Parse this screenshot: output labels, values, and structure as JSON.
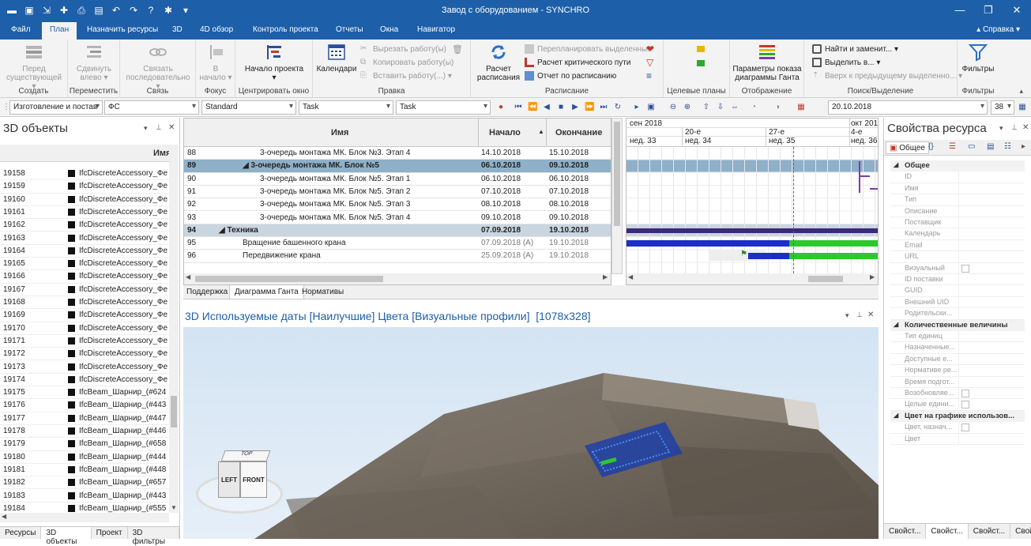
{
  "window": {
    "title": "Завод с оборудованием - SYNCHRO"
  },
  "menu": {
    "tabs": [
      "Файл",
      "План",
      "Назначить ресурсы",
      "3D",
      "4D обзор",
      "Контроль проекта",
      "Отчеты",
      "Окна",
      "Навигатор"
    ],
    "help": "Справка"
  },
  "ribbon": {
    "groups": [
      {
        "label": "Создать",
        "buttons": [
          "Перед существующей ▾"
        ]
      },
      {
        "label": "Переместить",
        "buttons": [
          "Сдвинуть влево ▾"
        ]
      },
      {
        "label": "Связь",
        "buttons": [
          "Связать последовательно ▾"
        ]
      },
      {
        "label": "Фокус",
        "buttons": [
          "В начало ▾"
        ]
      },
      {
        "label": "Центрировать окно",
        "buttons": [
          "Начало проекта ▾"
        ]
      },
      {
        "label": "Правка",
        "buttons": [
          "Календари"
        ],
        "small": [
          "Вырезать работу(ы)",
          "Копировать работу(ы)",
          "Вставить работу(...) ▾"
        ]
      },
      {
        "label": "Расписание",
        "buttons": [
          "Расчет расписания"
        ],
        "small": [
          "Перепланировать выделенные",
          "Расчет критического пути",
          "Отчет по расписанию"
        ]
      },
      {
        "label": "Целевые планы",
        "buttons": []
      },
      {
        "label": "Отображение",
        "buttons": [
          "Параметры показа диаграммы Ганта"
        ]
      },
      {
        "label": "Поиск/Выделение",
        "buttons": [],
        "small": [
          "Найти и заменит... ▾",
          "Выделить в... ▾",
          "Вверх к предыдущему выделенно... ▾"
        ]
      },
      {
        "label": "Фильтры",
        "buttons": [
          "Фильтры"
        ]
      }
    ]
  },
  "toolbar": {
    "combos": [
      "Изготовление и постав",
      "ФС",
      "Standard",
      "Task",
      "Task"
    ],
    "date": "20.10.2018",
    "zoom": "38"
  },
  "left_panel": {
    "title": "3D объекты",
    "col_header": "Имя",
    "rows": [
      {
        "id": "19158",
        "name": "IfcDiscreteAccessory_Фе"
      },
      {
        "id": "19159",
        "name": "IfcDiscreteAccessory_Фе"
      },
      {
        "id": "19160",
        "name": "IfcDiscreteAccessory_Фе"
      },
      {
        "id": "19161",
        "name": "IfcDiscreteAccessory_Фе"
      },
      {
        "id": "19162",
        "name": "IfcDiscreteAccessory_Фе"
      },
      {
        "id": "19163",
        "name": "IfcDiscreteAccessory_Фе"
      },
      {
        "id": "19164",
        "name": "IfcDiscreteAccessory_Фе"
      },
      {
        "id": "19165",
        "name": "IfcDiscreteAccessory_Фе"
      },
      {
        "id": "19166",
        "name": "IfcDiscreteAccessory_Фе"
      },
      {
        "id": "19167",
        "name": "IfcDiscreteAccessory_Фе"
      },
      {
        "id": "19168",
        "name": "IfcDiscreteAccessory_Фе"
      },
      {
        "id": "19169",
        "name": "IfcDiscreteAccessory_Фе"
      },
      {
        "id": "19170",
        "name": "IfcDiscreteAccessory_Фе"
      },
      {
        "id": "19171",
        "name": "IfcDiscreteAccessory_Фе"
      },
      {
        "id": "19172",
        "name": "IfcDiscreteAccessory_Фе"
      },
      {
        "id": "19173",
        "name": "IfcDiscreteAccessory_Фе"
      },
      {
        "id": "19174",
        "name": "IfcDiscreteAccessory_Фе"
      },
      {
        "id": "19175",
        "name": "IfcBeam_Шарнир_(#624"
      },
      {
        "id": "19176",
        "name": "IfcBeam_Шарнир_(#443"
      },
      {
        "id": "19177",
        "name": "IfcBeam_Шарнир_(#447"
      },
      {
        "id": "19178",
        "name": "IfcBeam_Шарнир_(#446"
      },
      {
        "id": "19179",
        "name": "IfcBeam_Шарнир_(#658"
      },
      {
        "id": "19180",
        "name": "IfcBeam_Шарнир_(#444"
      },
      {
        "id": "19181",
        "name": "IfcBeam_Шарнир_(#448"
      },
      {
        "id": "19182",
        "name": "IfcBeam_Шарнир_(#657"
      },
      {
        "id": "19183",
        "name": "IfcBeam_Шарнир_(#443"
      },
      {
        "id": "19184",
        "name": "IfcBeam_Шарнир_(#555"
      }
    ],
    "tabs": [
      "Ресурсы",
      "3D объекты",
      "Проект",
      "3D фильтры"
    ]
  },
  "grid": {
    "headers": {
      "name": "Имя",
      "start": "Начало",
      "end": "Окончание"
    },
    "rows": [
      {
        "n": "88",
        "name": "3-очередь монтажа МК. Блок №3. Этап 4",
        "start": "14.10.2018",
        "end": "15.10.2018",
        "lvl": 2,
        "type": "task"
      },
      {
        "n": "89",
        "name": "◢ 3-очередь монтажа МК. Блок №5",
        "start": "06.10.2018",
        "end": "09.10.2018",
        "lvl": 1,
        "type": "selected"
      },
      {
        "n": "90",
        "name": "3-очередь монтажа МК. Блок №5. Этап 1",
        "start": "06.10.2018",
        "end": "06.10.2018",
        "lvl": 2,
        "type": "task"
      },
      {
        "n": "91",
        "name": "3-очередь монтажа МК. Блок №5. Этап 2",
        "start": "07.10.2018",
        "end": "07.10.2018",
        "lvl": 2,
        "type": "task"
      },
      {
        "n": "92",
        "name": "3-очередь монтажа МК. Блок №5. Этап 3",
        "start": "08.10.2018",
        "end": "08.10.2018",
        "lvl": 2,
        "type": "task"
      },
      {
        "n": "93",
        "name": "3-очередь монтажа МК. Блок №5. Этап 4",
        "start": "09.10.2018",
        "end": "09.10.2018",
        "lvl": 2,
        "type": "task"
      },
      {
        "n": "94",
        "name": "◢ Техника",
        "start": "07.09.2018",
        "end": "19.10.2018",
        "lvl": 0,
        "type": "summary"
      },
      {
        "n": "95",
        "name": "Вращение башенного крана",
        "start": "07.09.2018 (A)",
        "end": "19.10.2018",
        "lvl": 1,
        "type": "actual"
      },
      {
        "n": "96",
        "name": "Передвижение крана",
        "start": "25.09.2018 (A)",
        "end": "19.10.2018",
        "lvl": 1,
        "type": "actual"
      }
    ],
    "tabs": [
      "Поддержка",
      "Диаграмма Ганта",
      "Нормативы"
    ]
  },
  "gantt": {
    "months": [
      "сен 2018",
      "окт 201"
    ],
    "weeks": [
      "20-е",
      "27-е",
      "4-е"
    ],
    "week_nums": [
      "нед. 33",
      "нед. 34",
      "нед. 35",
      "нед. 36"
    ]
  },
  "view": {
    "title": "3D Используемые даты [Наилучшие] Цвета [Визуальные профили]  [1078x328]",
    "cube": {
      "top": "TOP",
      "left": "LEFT",
      "front": "FRONT"
    }
  },
  "right_panel": {
    "title": "Свойства ресурса",
    "tab": "Общее",
    "categories": [
      {
        "name": "Общее",
        "props": [
          "ID",
          "Имя",
          "Тип",
          "Описание",
          "Поставщик",
          "Календарь",
          "Email",
          "URL",
          "Визуальный",
          "ID поставки",
          "GUID",
          "Внешний UID",
          "Родительски..."
        ]
      },
      {
        "name": "Количественные величины",
        "props": [
          "Тип единиц",
          "Назначенные...",
          "Доступные е...",
          "Нормативе ре...",
          "Время подгот...",
          "Возобновляе...",
          "Целые едини..."
        ]
      },
      {
        "name": "Цвет на графике использов...",
        "props": [
          "Цвет, назнач...",
          "Цвет"
        ]
      }
    ],
    "bottom_tabs": [
      "Свойст...",
      "Свойст...",
      "Свойст...",
      "Свойст..."
    ]
  },
  "colors": {
    "accent": "#1d5fa8",
    "selected_row": "#8fb0c9",
    "summary_row": "#c9d5df",
    "bar_blue": "#1b2fc4",
    "bar_green": "#2ec82e",
    "bar_purple": "#3b2a78"
  }
}
